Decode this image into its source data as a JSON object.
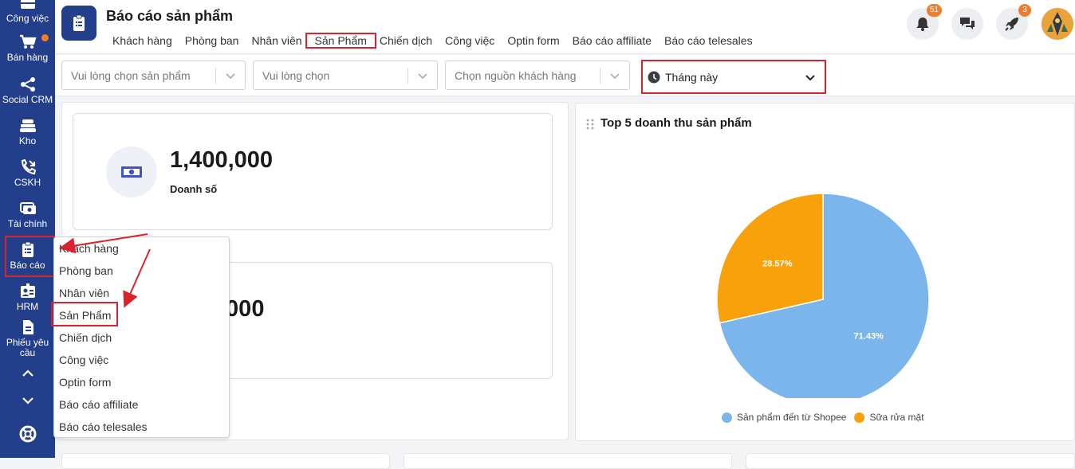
{
  "sidebar": {
    "items": [
      {
        "label": "Công việc",
        "icon": "briefcase-icon"
      },
      {
        "label": "Bán hàng",
        "icon": "cart-icon"
      },
      {
        "label": "Social CRM",
        "icon": "share-icon"
      },
      {
        "label": "Kho",
        "icon": "warehouse-icon"
      },
      {
        "label": "CSKH",
        "icon": "phone-icon"
      },
      {
        "label": "Tài chính",
        "icon": "money-icon"
      },
      {
        "label": "Báo cáo",
        "icon": "clipboard-icon"
      },
      {
        "label": "HRM",
        "icon": "id-card-icon"
      },
      {
        "label": "Phiếu yêu cầu",
        "icon": "document-icon"
      }
    ]
  },
  "header": {
    "title": "Báo cáo sản phẩm",
    "tabs": [
      "Khách hàng",
      "Phòng ban",
      "Nhân viên",
      "Sản Phẩm",
      "Chiến dịch",
      "Công việc",
      "Optin form",
      "Báo cáo affiliate",
      "Báo cáo telesales"
    ],
    "notifications_count": "51",
    "rocket_count": "3"
  },
  "filters": {
    "product_placeholder": "Vui lòng chọn sản phẩm",
    "generic_placeholder": "Vui lòng chọn",
    "source_placeholder": "Chọn nguồn khách hàng",
    "date_range": "Tháng này"
  },
  "stats": [
    {
      "value": "1,400,000",
      "label": "Doanh số"
    },
    {
      "value": ",000",
      "label": ""
    }
  ],
  "chart": {
    "title": "Top 5 doanh thu sản phẩm"
  },
  "chart_data": {
    "type": "pie",
    "title": "Top 5 doanh thu sản phẩm",
    "series": [
      {
        "name": "Sản phẩm đến từ Shopee",
        "value": 71.43,
        "label": "71.43%",
        "color": "#7cb5ec"
      },
      {
        "name": "Sữa rửa mặt",
        "value": 28.57,
        "label": "28.57%",
        "color": "#f9a10a"
      }
    ],
    "legend": "bottom"
  },
  "menu": {
    "items": [
      "Khách hàng",
      "Phòng ban",
      "Nhân viên",
      "Sản Phẩm",
      "Chiến dịch",
      "Công việc",
      "Optin form",
      "Báo cáo affiliate",
      "Báo cáo telesales"
    ]
  },
  "colors": {
    "sidebar": "#233f8c",
    "highlight": "#d9232d",
    "badge": "#f07d2a"
  }
}
